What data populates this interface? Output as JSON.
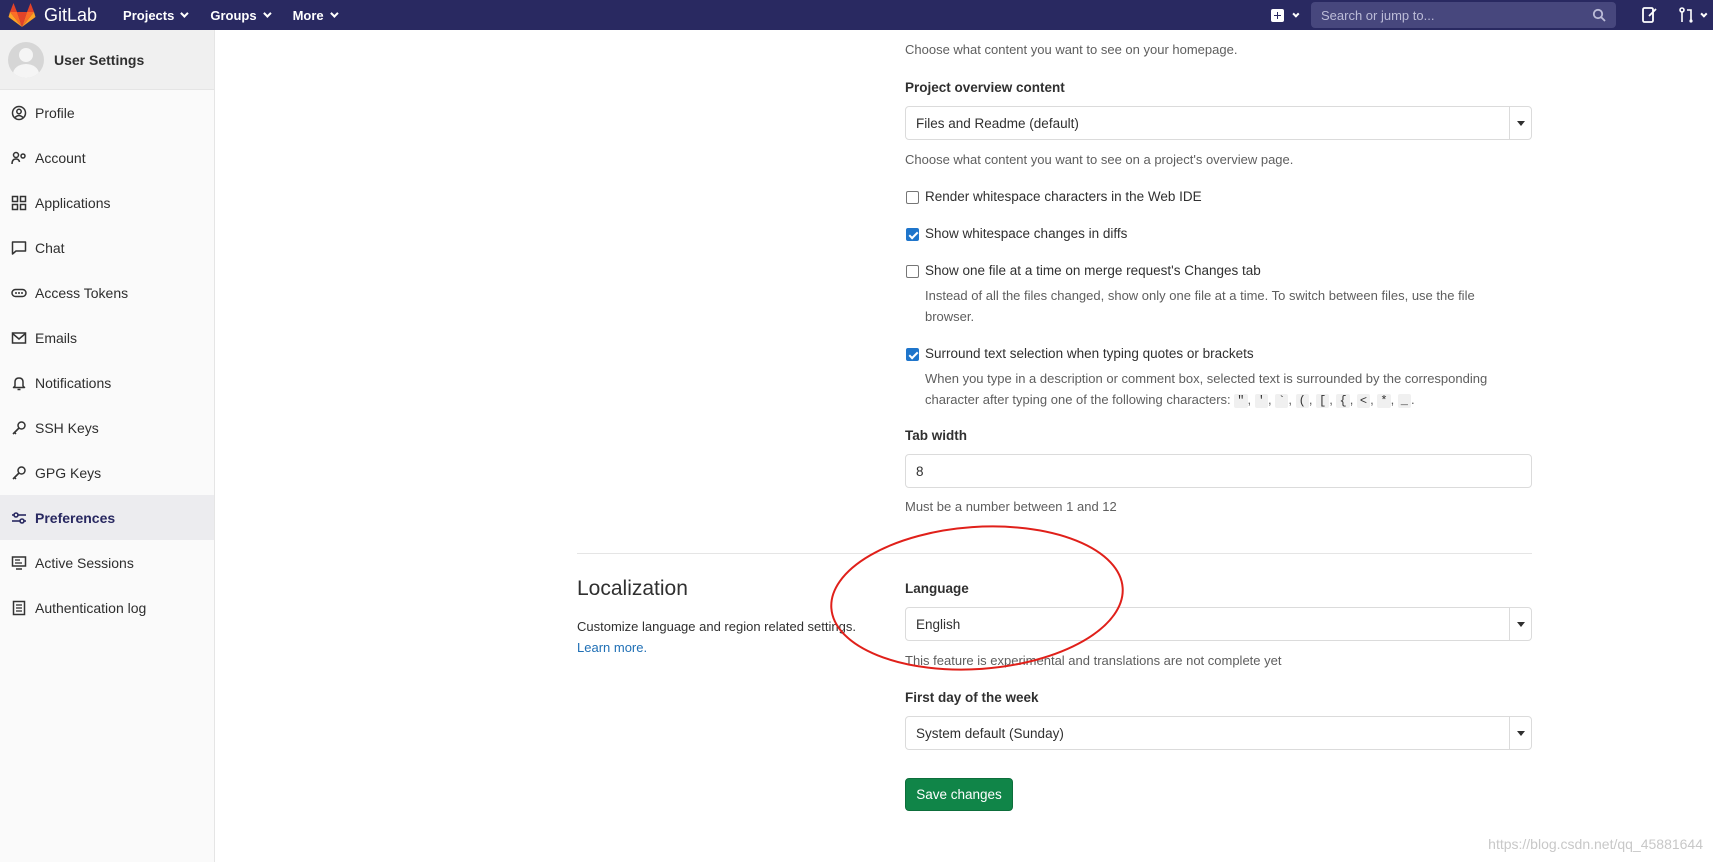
{
  "navbar": {
    "brand": "GitLab",
    "menu": [
      "Projects",
      "Groups",
      "More"
    ],
    "search_placeholder": "Search or jump to...",
    "colors": {
      "bg": "#292961",
      "search_bg": "#47477d"
    }
  },
  "sidebar": {
    "title": "User Settings",
    "items": [
      {
        "label": "Profile",
        "icon": "profile-icon"
      },
      {
        "label": "Account",
        "icon": "account-icon"
      },
      {
        "label": "Applications",
        "icon": "applications-icon"
      },
      {
        "label": "Chat",
        "icon": "chat-icon"
      },
      {
        "label": "Access Tokens",
        "icon": "token-icon"
      },
      {
        "label": "Emails",
        "icon": "email-icon"
      },
      {
        "label": "Notifications",
        "icon": "bell-icon"
      },
      {
        "label": "SSH Keys",
        "icon": "key-icon"
      },
      {
        "label": "GPG Keys",
        "icon": "key-icon"
      },
      {
        "label": "Preferences",
        "icon": "preferences-icon",
        "active": true
      },
      {
        "label": "Active Sessions",
        "icon": "monitor-icon"
      },
      {
        "label": "Authentication log",
        "icon": "log-icon"
      }
    ]
  },
  "behavior": {
    "homepage_help": "Choose what content you want to see on your homepage.",
    "overview_label": "Project overview content",
    "overview_value": "Files and Readme (default)",
    "overview_help": "Choose what content you want to see on a project's overview page.",
    "cb_whitespace_ide": {
      "label": "Render whitespace characters in the Web IDE",
      "checked": false
    },
    "cb_whitespace_diffs": {
      "label": "Show whitespace changes in diffs",
      "checked": true
    },
    "cb_one_file": {
      "label": "Show one file at a time on merge request's Changes tab",
      "checked": false,
      "help_line1": "Instead of all the files changed, show only one file at a time. To switch between files, use the file",
      "help_line2": "browser."
    },
    "cb_surround": {
      "label": "Surround text selection when typing quotes or brackets",
      "checked": true,
      "help_line1": "When you type in a description or comment box, selected text is surrounded by the corresponding",
      "help_line2_prefix": "character after typing one of the following characters:",
      "chars": [
        "\"",
        "'",
        "`",
        "(",
        "[",
        "{",
        "<",
        "*",
        "_"
      ]
    },
    "tab_width_label": "Tab width",
    "tab_width_value": "8",
    "tab_width_help": "Must be a number between 1 and 12"
  },
  "localization": {
    "title": "Localization",
    "description": "Customize language and region related settings.",
    "learn_more": "Learn more",
    "language_label": "Language",
    "language_value": "English",
    "language_help": "This feature is experimental and translations are not complete yet",
    "first_day_label": "First day of the week",
    "first_day_value": "System default (Sunday)"
  },
  "save_button": "Save changes",
  "watermark": "https://blog.csdn.net/qq_45881644",
  "annotation_color": "#e0201a"
}
